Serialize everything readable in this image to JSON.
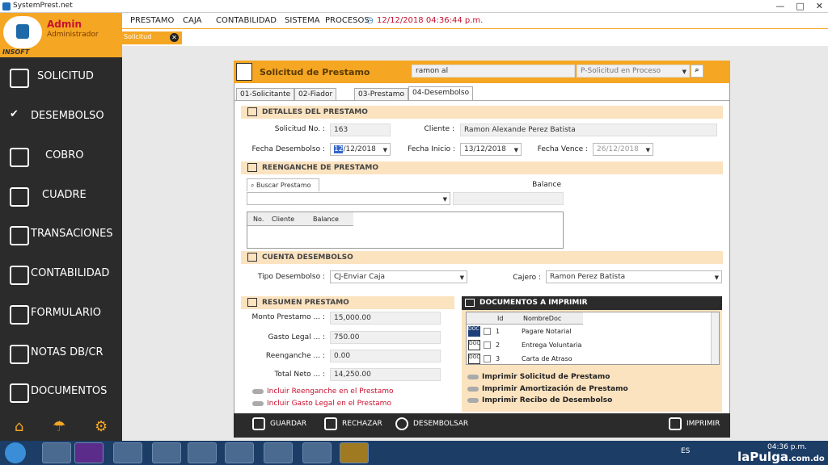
{
  "window": {
    "title": "SystemPrest.net"
  },
  "brand": {
    "user": "Admin",
    "role": "Administrador",
    "company": "INSOFT"
  },
  "sidebar": {
    "items": [
      {
        "label": "SOLICITUD",
        "icon": "document-icon"
      },
      {
        "label": "DESEMBOLSO",
        "icon": "checkmark-icon"
      },
      {
        "label": "COBRO",
        "icon": "money-hand-icon"
      },
      {
        "label": "CUADRE",
        "icon": "calculator-icon"
      },
      {
        "label": "TRANSACIONES",
        "icon": "transactions-icon"
      },
      {
        "label": "CONTABILIDAD",
        "icon": "accounting-icon"
      },
      {
        "label": "FORMULARIO",
        "icon": "form-icon"
      },
      {
        "label": "NOTAS DB/CR",
        "icon": "notes-icon"
      },
      {
        "label": "DOCUMENTOS",
        "icon": "doc-icon"
      }
    ]
  },
  "menu": {
    "items": [
      "PRESTAMO",
      "CAJA",
      "CONTABILIDAD",
      "SISTEMA",
      "PROCESOS"
    ],
    "datetime": "12/12/2018 04:36:44 p.m."
  },
  "open_tab": {
    "label": "Solicitud"
  },
  "form": {
    "title": "Solicitud de Prestamo",
    "search_value": "ramon al",
    "status_value": "P-Solicitud en Proceso",
    "tabs": [
      "01-Solicitante",
      "02-Fiador",
      "03-Prestamo",
      "04-Desembolso"
    ],
    "details": {
      "section": "DETALLES DEL PRESTAMO",
      "solicitud_label": "Solicitud No. :",
      "solicitud_value": "163",
      "cliente_label": "Cliente :",
      "cliente_value": "Ramon Alexande Perez Batista",
      "fecha_desembolso_label": "Fecha Desembolso :",
      "fecha_desembolso_day": "12",
      "fecha_desembolso_rest": "/12/2018",
      "fecha_inicio_label": "Fecha Inicio :",
      "fecha_inicio_value": "13/12/2018",
      "fecha_vence_label": "Fecha Vence :",
      "fecha_vence_value": "26/12/2018"
    },
    "reenganche": {
      "section": "REENGANCHE DE PRESTAMO",
      "buscar_label": "Buscar Prestamo",
      "balance_label": "Balance",
      "columns": [
        "No.",
        "Cliente",
        "Balance"
      ]
    },
    "cuenta": {
      "section": "CUENTA DESEMBOLSO",
      "tipo_label": "Tipo Desembolso :",
      "tipo_value": "CJ-Enviar Caja",
      "cajero_label": "Cajero :",
      "cajero_value": "Ramon Perez Batista"
    },
    "resumen": {
      "section": "RESUMEN PRESTAMO",
      "monto_label": "Monto Prestamo ... :",
      "monto_value": "15,000.00",
      "gasto_label": "Gasto Legal ... :",
      "gasto_value": "750.00",
      "reenganche_label": "Reenganche ... :",
      "reenganche_value": "0.00",
      "neto_label": "Total Neto ... :",
      "neto_value": "14,250.00",
      "incluir_reenganche": "Incluir Reenganche en el Prestamo",
      "incluir_gasto": "Incluir Gasto Legal en el Prestamo"
    },
    "documentos": {
      "section": "DOCUMENTOS A IMPRIMIR",
      "columns": [
        "Id",
        "NombreDoc"
      ],
      "rows": [
        {
          "id": "1",
          "name": "Pagare Notarial"
        },
        {
          "id": "2",
          "name": "Entrega Voluntaria"
        },
        {
          "id": "3",
          "name": "Carta de Atraso"
        }
      ],
      "options": [
        "Imprimir Solicitud de Prestamo",
        "Imprimir Amortización de Prestamo",
        "Imprimir Recibo de Desembolso"
      ]
    },
    "footer": {
      "guardar": "GUARDAR",
      "rechazar": "RECHAZAR",
      "desembolsar": "DESEMBOLSAR",
      "imprimir": "IMPRIMIR"
    }
  },
  "taskbar": {
    "lang": "ES",
    "time": "04:36 p.m."
  },
  "watermark": {
    "brand": "laPulga",
    "domain": ".com.do"
  }
}
